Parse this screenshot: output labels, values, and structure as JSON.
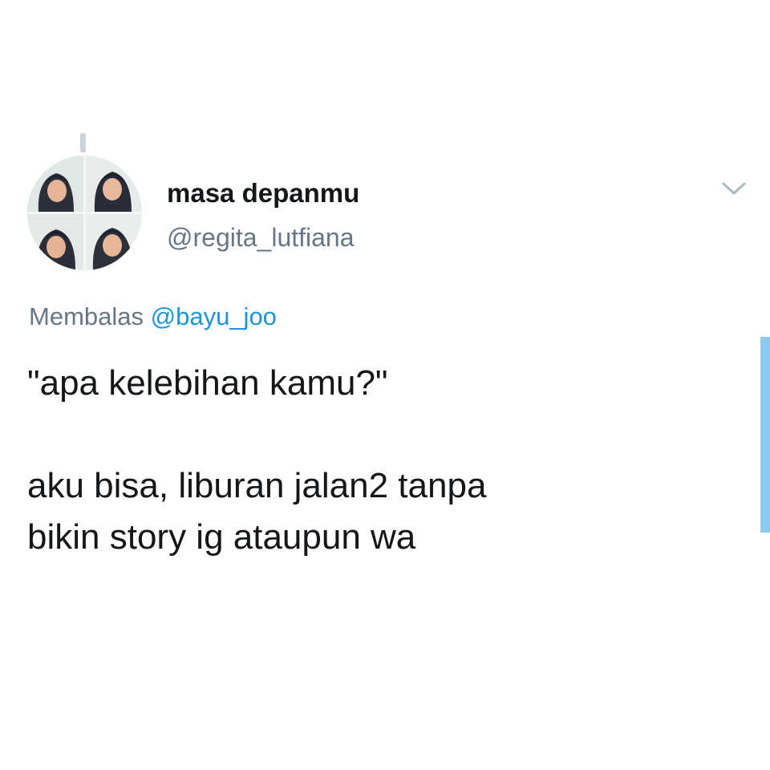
{
  "tweet": {
    "display_name": "masa depanmu",
    "handle": "@regita_lutfiana",
    "reply_prefix": "Membalas",
    "reply_to": "@bayu_joo",
    "text": "\"apa kelebihan kamu?\"\n\naku bisa, liburan jalan2 tanpa\nbikin story ig ataupun wa",
    "avatar_icon": "profile-photo-collage",
    "more_icon": "chevron-down-icon"
  },
  "colors": {
    "name": "#14171a",
    "muted": "#657786",
    "mention": "#1b95e0",
    "scrollbar": "#8cc8ef"
  }
}
